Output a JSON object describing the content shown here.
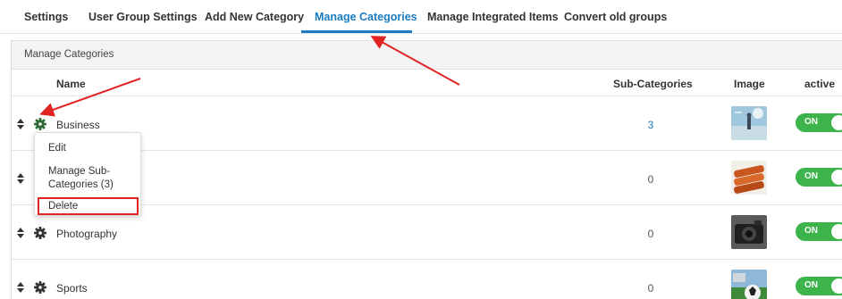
{
  "tabs": [
    {
      "label": "Settings",
      "active": false
    },
    {
      "label": "User Group Settings",
      "active": false
    },
    {
      "label": "Add New Category",
      "active": false
    },
    {
      "label": "Manage Categories",
      "active": true
    },
    {
      "label": "Manage Integrated Items",
      "active": false
    },
    {
      "label": "Convert old groups",
      "active": false
    }
  ],
  "panel": {
    "title": "Manage Categories",
    "columns": {
      "name": "Name",
      "sub_categories": "Sub-Categories",
      "image": "Image",
      "active": "active"
    }
  },
  "categories": [
    {
      "name": "Business",
      "sub_count": "3",
      "sub_is_link": true,
      "image": "business-photo",
      "toggle": "ON"
    },
    {
      "name": "",
      "sub_count": "0",
      "sub_is_link": false,
      "image": "food-photo",
      "toggle": "ON"
    },
    {
      "name": "Photography",
      "sub_count": "0",
      "sub_is_link": false,
      "image": "camera-photo",
      "toggle": "ON"
    },
    {
      "name": "Sports",
      "sub_count": "0",
      "sub_is_link": false,
      "image": "sports-photo",
      "toggle": "ON"
    }
  ],
  "menu": {
    "edit": "Edit",
    "manage_sub": "Manage Sub-Categories (3)",
    "delete": "Delete"
  },
  "colors": {
    "accent": "#1a7bc1",
    "toggle_on": "#3cb44b",
    "annotation": "#e02424",
    "gear": "#2d6b35"
  }
}
